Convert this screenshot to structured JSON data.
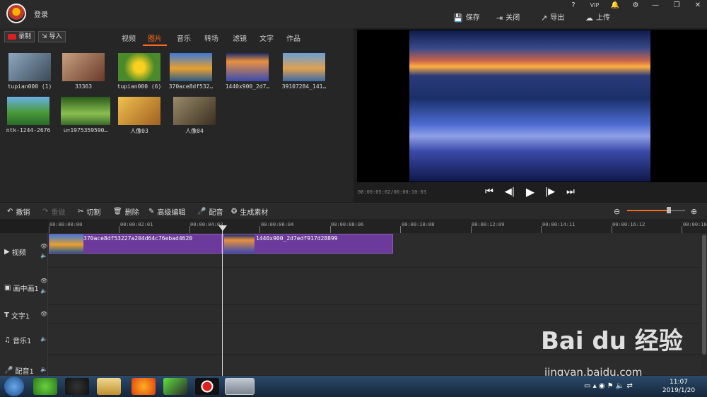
{
  "titlebar": {
    "login": "登录",
    "help": "?",
    "vip": "VIP",
    "toolbar": [
      "保存",
      "关闭",
      "导出",
      "上传"
    ]
  },
  "media": {
    "record": "录制",
    "import": "导入",
    "tabs": [
      "视频",
      "图片",
      "音乐",
      "转场",
      "滤镜",
      "文字",
      "作品"
    ],
    "active_tab": "图片",
    "items": [
      {
        "label": "tupian000 (1)",
        "color": "#5a6a78"
      },
      {
        "label": "33363",
        "color": "#8a5a4a"
      },
      {
        "label": "tupian000 (6)",
        "color": "#8aa83a"
      },
      {
        "label": "370ace8df532…",
        "color": "#3a6ab0"
      },
      {
        "label": "1440x900_2d7…",
        "color": "#2a3a8a"
      },
      {
        "label": "39107284_141…",
        "color": "#4a7ab8"
      },
      {
        "label": "ntk-1244-2676",
        "color": "#4a8a3a"
      },
      {
        "label": "u=1975359590…",
        "color": "#3a6a2a"
      },
      {
        "label": "人像03",
        "color": "#c8a040"
      },
      {
        "label": "人像04",
        "color": "#6a5a3a"
      }
    ]
  },
  "preview": {
    "timecode": "00:00:05:02/00:00:10:03"
  },
  "editbar": {
    "undo": "撤销",
    "redo": "重做",
    "cut": "切割",
    "delete": "删除",
    "advanced": "高级编辑",
    "dub": "配音",
    "generate": "生成素材"
  },
  "ruler": [
    "00:00:00:00",
    "00:00:02:01",
    "00:00:04:03",
    "00:00:06:04",
    "00:00:08:06",
    "00:00:10:08",
    "00:00:12:09",
    "00:00:14:11",
    "00:00:16:12",
    "00:00:18:"
  ],
  "tracks": [
    "视频",
    "画中画1",
    "文字1",
    "音乐1",
    "配音1"
  ],
  "clips": [
    {
      "label": "370ace8df53227a204d64c76ebad4620"
    },
    {
      "label": "1440x900_2d7edf917d28899"
    }
  ],
  "clock": {
    "time": "11:07",
    "date": "2019/1/20"
  },
  "watermark": {
    "brand": "Bai du 经验",
    "url": "jingyan.baidu.com"
  }
}
